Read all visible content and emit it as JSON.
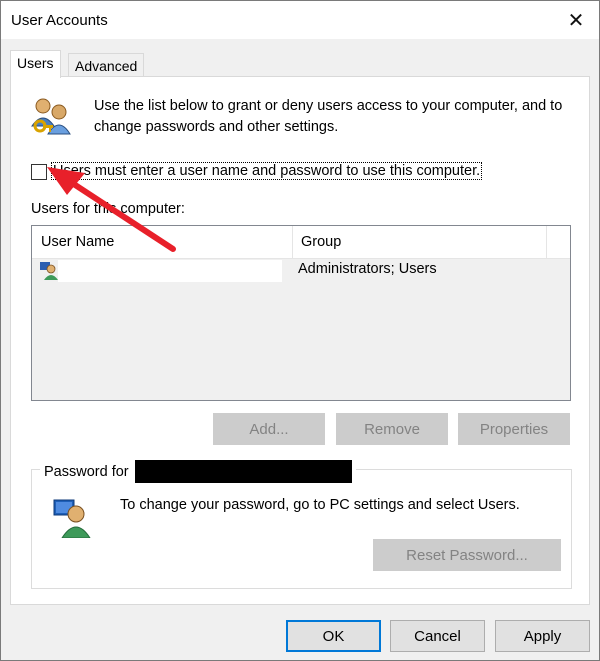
{
  "window": {
    "title": "User Accounts",
    "close_glyph": "✕"
  },
  "tabs": [
    {
      "label": "Users",
      "active": true
    },
    {
      "label": "Advanced",
      "active": false
    }
  ],
  "users_tab": {
    "info_text": "Use the list below to grant or deny users access to your computer, and to change passwords and other settings.",
    "must_login_checkbox": {
      "label": "Users must enter a user name and password to use this computer.",
      "checked": false
    },
    "list_label": "Users for this computer:",
    "columns": [
      "User Name",
      "Group"
    ],
    "rows": [
      {
        "user_name": "",
        "group": "Administrators; Users"
      }
    ],
    "buttons": {
      "add": "Add...",
      "remove": "Remove",
      "properties": "Properties"
    },
    "password_group": {
      "legend": "Password for",
      "text": "To change your password, go to PC settings and select Users.",
      "reset_button": "Reset Password..."
    }
  },
  "footer": {
    "ok": "OK",
    "cancel": "Cancel",
    "apply": "Apply"
  },
  "annotation": {
    "arrow_color": "#e8202a"
  },
  "colors": {
    "accent": "#0078d7",
    "disabled_text": "#838383"
  }
}
